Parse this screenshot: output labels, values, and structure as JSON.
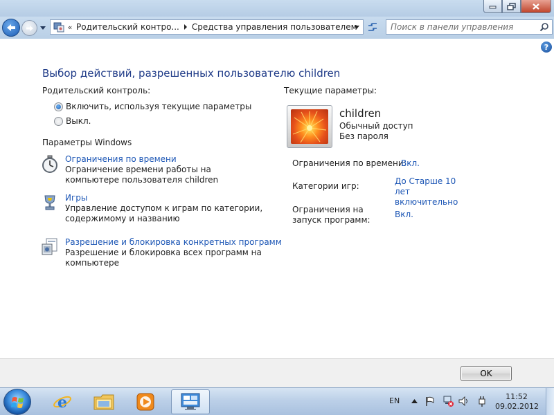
{
  "window": {
    "minimize_icon": "minimize-icon",
    "maximize_icon": "restore-icon",
    "close_icon": "close-icon"
  },
  "navbar": {
    "breadcrumb": [
      {
        "label": "Родительский контро..."
      },
      {
        "label": "Средства управления пользователем"
      }
    ],
    "chevron": "«",
    "search_placeholder": "Поиск в панели управления"
  },
  "content": {
    "heading": "Выбор действий, разрешенных пользователю children",
    "parental_control_label": "Родительский контроль:",
    "radio_on": "Включить, используя текущие параметры",
    "radio_off": "Выкл.",
    "windows_settings_label": "Параметры Windows",
    "tasks": [
      {
        "title": "Ограничения по времени",
        "desc": "Ограничение времени работы на компьютере пользователя children",
        "icon": "stopwatch-icon"
      },
      {
        "title": "Игры",
        "desc": "Управление доступом к играм по категории, содержимому и названию",
        "icon": "trophy-icon"
      },
      {
        "title": "Разрешение и блокировка конкретных программ",
        "desc": "Разрешение и блокировка всех программ на компьютере",
        "icon": "programs-icon"
      }
    ],
    "current_settings_label": "Текущие параметры:",
    "user": {
      "name": "children",
      "account_type": "Обычный доступ",
      "password": "Без пароля"
    },
    "settings": [
      {
        "label": "Ограничения по времени:",
        "value": "Вкл."
      },
      {
        "label": "Категории игр:",
        "value": "До Старше 10 лет включительно"
      },
      {
        "label": "Ограничения на запуск программ:",
        "value": "Вкл."
      }
    ]
  },
  "bottom": {
    "ok_label": "OK"
  },
  "taskbar": {
    "language": "EN",
    "time": "11:52",
    "date": "09.02.2012",
    "apps": [
      "internet-explorer-icon",
      "folder-icon",
      "media-player-icon",
      "control-panel-icon"
    ]
  },
  "colors": {
    "link": "#1c56b5",
    "heading": "#1e3a87"
  }
}
